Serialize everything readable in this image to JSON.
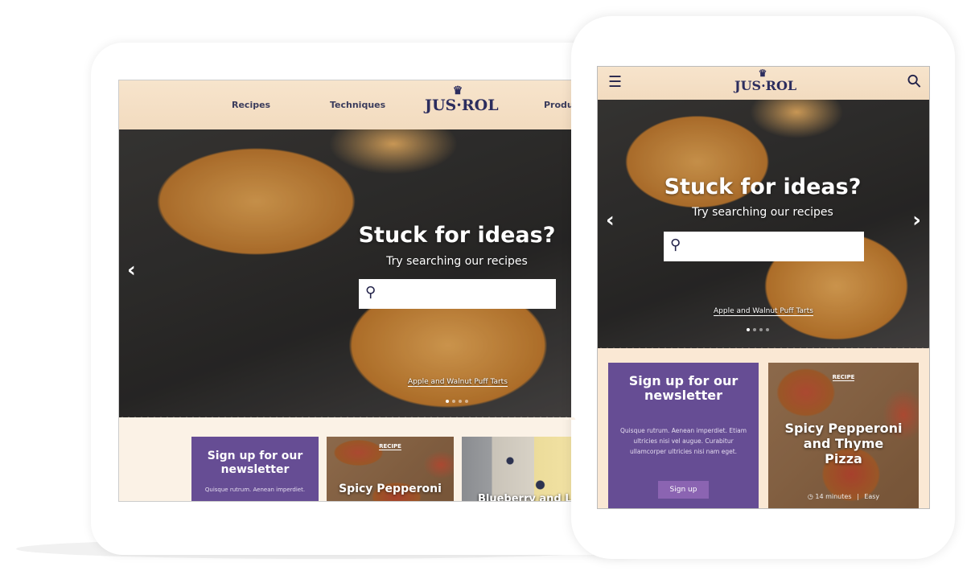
{
  "brand": {
    "logo": "JUS·ROL",
    "accent": "#664d94",
    "button": "#8b64b2",
    "header_bg": "#f4dfc4"
  },
  "tablet": {
    "nav": [
      "Recipes",
      "Techniques",
      "Produc"
    ],
    "hero": {
      "title": "Stuck for ideas?",
      "subtitle": "Try searching our recipes",
      "search_placeholder": "",
      "caption": "Apple and Walnut Puff Tarts",
      "slides": 4,
      "active_slide": 1
    },
    "newsletter": {
      "title": "Sign up for our newsletter",
      "body": "Quisque rutrum. Aenean imperdiet."
    },
    "cards": [
      {
        "tag": "RECIPE",
        "title": "Spicy Pepperoni"
      },
      {
        "title": "Blueberry and L"
      }
    ]
  },
  "phone": {
    "hero": {
      "title": "Stuck for ideas?",
      "subtitle": "Try searching our recipes",
      "search_placeholder": "",
      "caption": "Apple and Walnut Puff Tarts",
      "slides": 4,
      "active_slide": 1
    },
    "newsletter": {
      "title": "Sign up for our newsletter",
      "body": "Quisque rutrum. Aenean imperdiet. Etiam ultricies nisi vel augue. Curabitur ullamcorper ultricies nisi nam eget.",
      "button": "Sign up"
    },
    "card": {
      "tag": "RECIPE",
      "title": "Spicy Pepperoni and Thyme Pizza",
      "time": "14 minutes",
      "difficulty": "Easy"
    }
  },
  "icons": {
    "menu": "hamburger-icon",
    "search": "search-icon",
    "prev": "chevron-left-icon",
    "next": "chevron-right-icon",
    "clock": "clock-icon",
    "crown": "crown-icon"
  }
}
